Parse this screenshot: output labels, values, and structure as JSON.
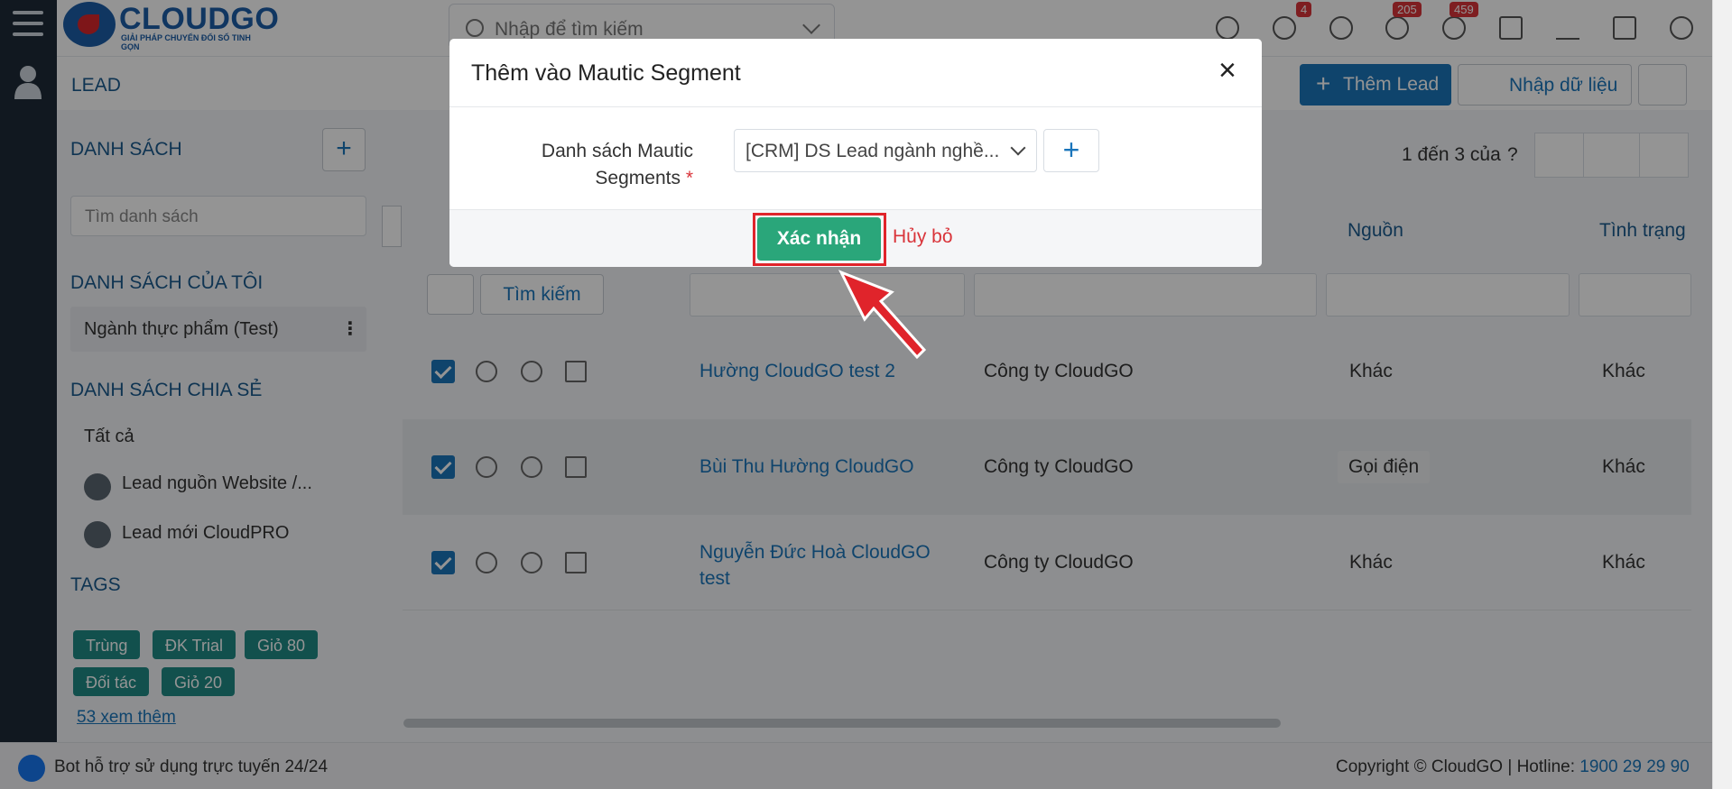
{
  "app": {
    "brand": "CLOUDGO",
    "brand_tagline": "GIẢI PHÁP CHUYỂN ĐỔI SỐ TINH GỌN",
    "search_placeholder": "Nhập để tìm kiếm"
  },
  "header": {
    "badge_megaphone": "4",
    "badge_bell": "205",
    "badge_chat": "459"
  },
  "subbar": {
    "title": "LEAD",
    "add_lead": "Thêm Lead",
    "import_data": "Nhập dữ liệu"
  },
  "sidebar": {
    "list_title": "DANH SÁCH",
    "search_placeholder": "Tìm danh sách",
    "my_lists_title": "DANH SÁCH CỦA TÔI",
    "my_lists": [
      "Ngành thực phẩm (Test)"
    ],
    "shared_title": "DANH SÁCH CHIA SẺ",
    "shared_items": [
      "Tất cả",
      "Lead nguồn Website /...",
      "Lead mới CloudPRO"
    ],
    "tags_title": "TAGS",
    "tags": [
      "Trùng",
      "ĐK Trial",
      "Giỏ 80",
      "Đối tác",
      "Giỏ 20"
    ],
    "more_link": "53  xem thêm"
  },
  "table": {
    "pagination_text": "1 đến 3 của",
    "pagination_help": "?",
    "col_source": "Nguồn",
    "col_status": "Tình trạng",
    "search_button": "Tìm kiếm",
    "rows": [
      {
        "name": "Hường CloudGO test 2",
        "company": "Công ty CloudGO",
        "source": "Khác",
        "status": "Khác"
      },
      {
        "name": "Bùi Thu Hường CloudGO",
        "company": "Công ty CloudGO",
        "source": "Gọi điện",
        "status": "Khác"
      },
      {
        "name": "Nguyễn Đức Hoà CloudGO test",
        "company": "Công ty CloudGO",
        "source": "Khác",
        "status": "Khác"
      }
    ]
  },
  "modal": {
    "title": "Thêm vào Mautic Segment",
    "field_label": "Danh sách Mautic Segments",
    "required_mark": "*",
    "selected_value": "[CRM] DS Lead ngành nghề...",
    "confirm": "Xác nhận",
    "cancel": "Hủy bỏ"
  },
  "footer": {
    "bot_text": "Bot hỗ trợ sử dụng trực tuyến 24/24",
    "copyright": "Copyright © CloudGO | Hotline: ",
    "hotline": "1900 29 29 90"
  },
  "colors": {
    "primary": "#1a75bb",
    "confirm": "#2aa67a",
    "highlight": "#e0242b",
    "tag": "#1f8a86"
  }
}
